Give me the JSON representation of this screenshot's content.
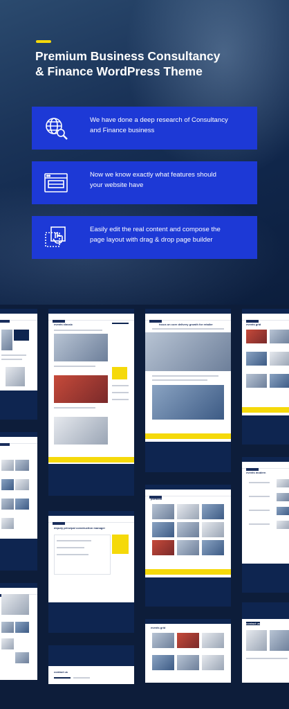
{
  "header": {
    "title_line1": "Premium Business Consultancy",
    "title_line2": "& Finance WordPress Theme",
    "accent_color": "#f5d90a"
  },
  "features": [
    {
      "icon": "globe-search-icon",
      "line1": "We have done a deep research of Consultancy",
      "line2": "and Finance business"
    },
    {
      "icon": "layout-icon",
      "line1": "Now we know exactly what features should",
      "line2": "your website have"
    },
    {
      "icon": "drag-drop-icon",
      "line1": "Easily edit the real content and compose the",
      "line2": "page layout with drag & drop page builder"
    }
  ],
  "feature_color": "#1d39d6",
  "background_color": "#0d1d3a",
  "mockups": {
    "headings": {
      "events_classic": "events classic",
      "focus": "focus on core delivery growth for retailer",
      "events_grid": "events grid",
      "deputy": "deputy principal construction manager",
      "portfolio": "portfolio",
      "events_modern": "events modern",
      "contact_us": "contact us",
      "events_grid_2": "events grid",
      "contact_us_2": "contact us"
    }
  }
}
